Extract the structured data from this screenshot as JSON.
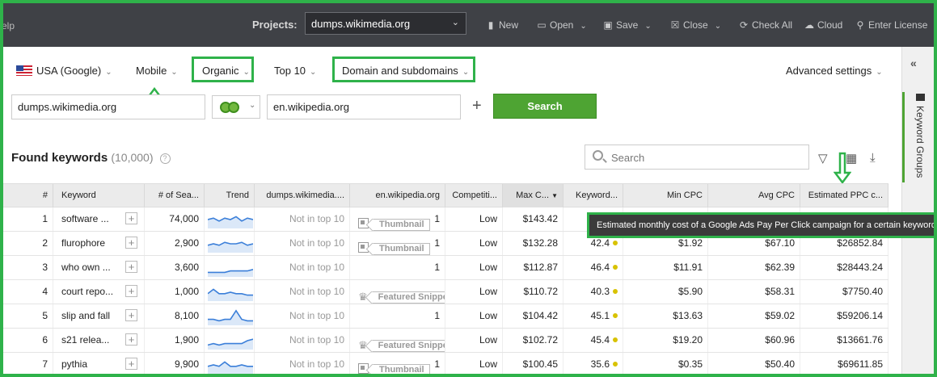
{
  "topbar": {
    "help_label": "elp",
    "projects_label": "Projects:",
    "project_value": "dumps.wikimedia.org",
    "new_label": "New",
    "open_label": "Open",
    "save_label": "Save",
    "close_label": "Close",
    "check_all_label": "Check All",
    "cloud_label": "Cloud",
    "enter_license_label": "Enter License"
  },
  "filters": {
    "country": "USA (Google)",
    "device": "Mobile",
    "search_type": "Organic",
    "top": "Top 10",
    "scope": "Domain and subdomains",
    "advanced": "Advanced settings"
  },
  "inputs": {
    "domain1": "dumps.wikimedia.org",
    "domain2": "en.wikipedia.org",
    "search_button": "Search"
  },
  "side_panel": {
    "label": "Keyword Groups"
  },
  "results": {
    "title": "Found keywords",
    "count": "(10,000)",
    "help": "?",
    "search_placeholder": "Search"
  },
  "table": {
    "columns": [
      "#",
      "Keyword",
      "# of Sea...",
      "Trend",
      "dumps.wikimedia....",
      "en.wikipedia.org",
      "Competiti...",
      "Max C...",
      "Keyword...",
      "Min CPC",
      "Avg CPC",
      "Estimated PPC c..."
    ],
    "rows": [
      {
        "n": "1",
        "keyword": "software ...",
        "searches": "74,000",
        "trend": [
          5,
          6,
          4,
          6,
          5,
          7,
          4,
          6,
          5
        ],
        "d1": "Not in top 10",
        "badge": "thumb",
        "badge_label": "Thumbnail",
        "d2": "1",
        "comp": "Low",
        "max": "$143.42",
        "kd": "",
        "min": "",
        "avg": "",
        "ppc": ""
      },
      {
        "n": "2",
        "keyword": "flurophore",
        "searches": "2,900",
        "trend": [
          4,
          5,
          4,
          6,
          5,
          5,
          6,
          4,
          5
        ],
        "d1": "Not in top 10",
        "badge": "thumb",
        "badge_label": "Thumbnail",
        "d2": "1",
        "comp": "Low",
        "max": "$132.28",
        "kd": "42.4",
        "min": "$1.92",
        "avg": "$67.10",
        "ppc": "$26852.84"
      },
      {
        "n": "3",
        "keyword": "who own ...",
        "searches": "3,600",
        "trend": [
          2,
          2,
          2,
          2,
          3,
          3,
          3,
          3,
          4
        ],
        "d1": "Not in top 10",
        "badge": "",
        "badge_label": "",
        "d2": "1",
        "comp": "Low",
        "max": "$112.87",
        "kd": "46.4",
        "min": "$11.91",
        "avg": "$62.39",
        "ppc": "$28443.24"
      },
      {
        "n": "4",
        "keyword": "court repo...",
        "searches": "1,000",
        "trend": [
          4,
          7,
          4,
          4,
          5,
          4,
          4,
          3,
          3
        ],
        "d1": "Not in top 10",
        "badge": "crown",
        "badge_label": "Featured Snippet",
        "d2": "",
        "comp": "Low",
        "max": "$110.72",
        "kd": "40.3",
        "min": "$5.90",
        "avg": "$58.31",
        "ppc": "$7750.40"
      },
      {
        "n": "5",
        "keyword": "slip and fall",
        "searches": "8,100",
        "trend": [
          3,
          3,
          2,
          3,
          3,
          9,
          3,
          2,
          2
        ],
        "d1": "Not in top 10",
        "badge": "",
        "badge_label": "",
        "d2": "1",
        "comp": "Low",
        "max": "$104.42",
        "kd": "45.1",
        "min": "$13.63",
        "avg": "$59.02",
        "ppc": "$59206.14"
      },
      {
        "n": "6",
        "keyword": "s21 relea...",
        "searches": "1,900",
        "trend": [
          2,
          3,
          2,
          3,
          3,
          3,
          3,
          5,
          6
        ],
        "d1": "Not in top 10",
        "badge": "crown",
        "badge_label": "Featured Snippet",
        "d2": "",
        "comp": "Low",
        "max": "$102.72",
        "kd": "45.4",
        "min": "$19.20",
        "avg": "$60.96",
        "ppc": "$13661.76"
      },
      {
        "n": "7",
        "keyword": "pythia",
        "searches": "9,900",
        "trend": [
          4,
          5,
          4,
          7,
          4,
          4,
          5,
          4,
          4
        ],
        "d1": "Not in top 10",
        "badge": "thumb",
        "badge_label": "Thumbnail",
        "d2": "1",
        "comp": "Low",
        "max": "$100.45",
        "kd": "35.6",
        "min": "$0.35",
        "avg": "$50.40",
        "ppc": "$69611.85"
      }
    ]
  },
  "tooltip": {
    "text": "Estimated monthly cost of a Google Ads Pay Per Click campaign for a certain keyword."
  },
  "colors": {
    "highlight": "#2fb24a",
    "search_button": "#4ea433",
    "topbar": "#3f4146",
    "trend_line": "#3b7fd9",
    "trend_fill": "#dbe8f8"
  }
}
